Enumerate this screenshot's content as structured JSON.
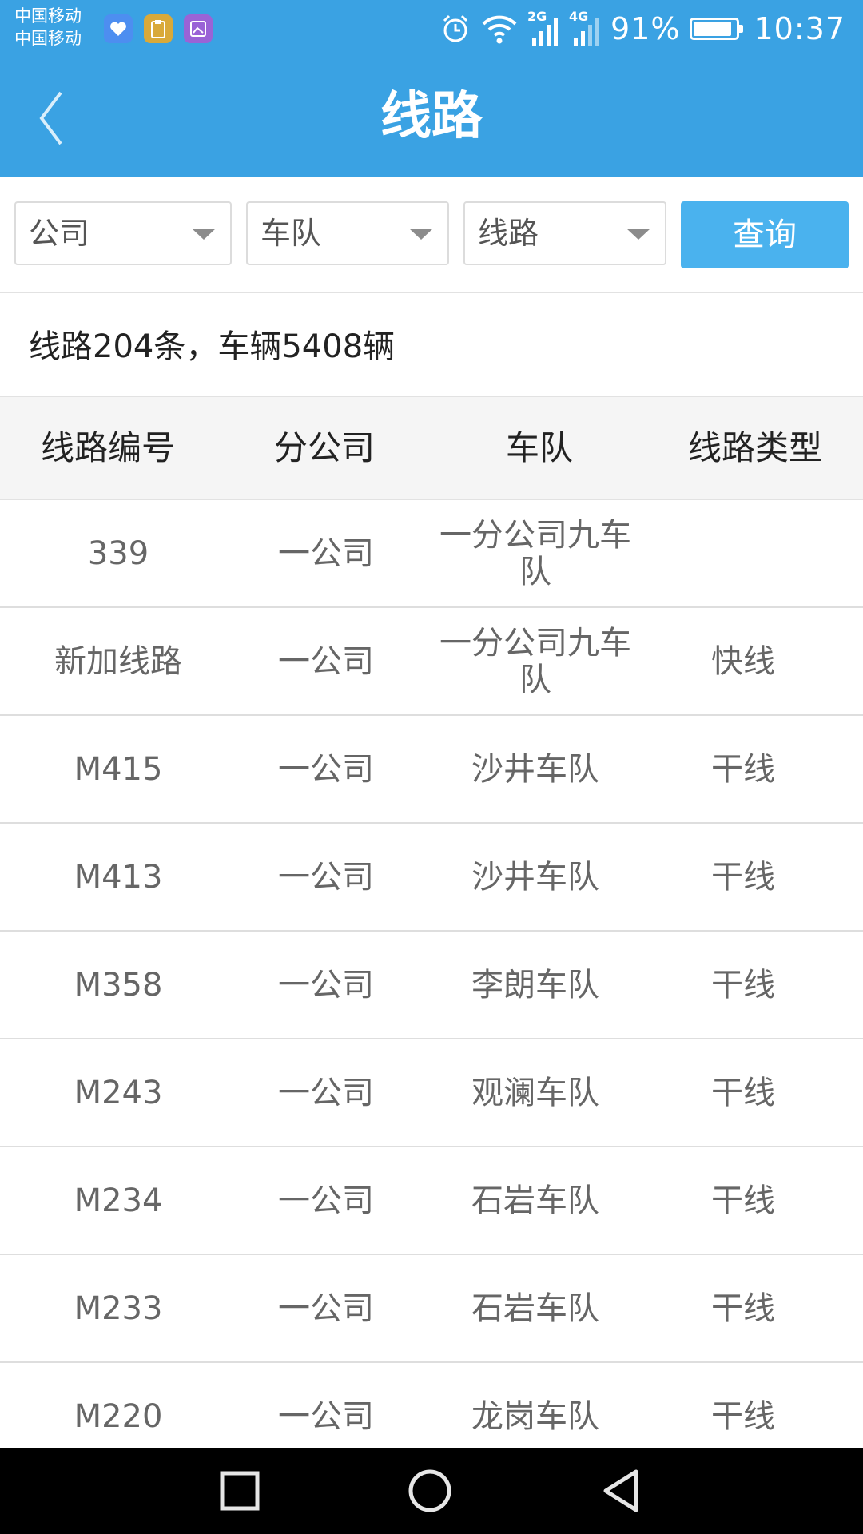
{
  "status_bar": {
    "carrier_1": "中国移动",
    "carrier_2": "中国移动",
    "signal_1_label": "2G",
    "signal_2_label": "4G",
    "battery_percent": "91%",
    "battery_level": 0.91,
    "time": "10:37",
    "notification_icons": [
      "health-app-icon",
      "clipboard-app-icon",
      "gallery-app-icon"
    ]
  },
  "header": {
    "title": "线路"
  },
  "filters": {
    "company_label": "公司",
    "fleet_label": "车队",
    "route_label": "线路",
    "query_button": "查询"
  },
  "summary": "线路204条，车辆5408辆",
  "table": {
    "columns": [
      "线路编号",
      "分公司",
      "车队",
      "线路类型"
    ],
    "rows": [
      {
        "route": "339",
        "branch": "一公司",
        "fleet": "一分公司九车队",
        "type": ""
      },
      {
        "route": "新加线路",
        "branch": "一公司",
        "fleet": "一分公司九车队",
        "type": "快线"
      },
      {
        "route": "M415",
        "branch": "一公司",
        "fleet": "沙井车队",
        "type": "干线"
      },
      {
        "route": "M413",
        "branch": "一公司",
        "fleet": "沙井车队",
        "type": "干线"
      },
      {
        "route": "M358",
        "branch": "一公司",
        "fleet": "李朗车队",
        "type": "干线"
      },
      {
        "route": "M243",
        "branch": "一公司",
        "fleet": "观澜车队",
        "type": "干线"
      },
      {
        "route": "M234",
        "branch": "一公司",
        "fleet": "石岩车队",
        "type": "干线"
      },
      {
        "route": "M233",
        "branch": "一公司",
        "fleet": "石岩车队",
        "type": "干线"
      },
      {
        "route": "M220",
        "branch": "一公司",
        "fleet": "龙岗车队",
        "type": "干线"
      }
    ]
  },
  "colors": {
    "header_bg": "#3aa2e3",
    "button_bg": "#4ab2ee"
  }
}
